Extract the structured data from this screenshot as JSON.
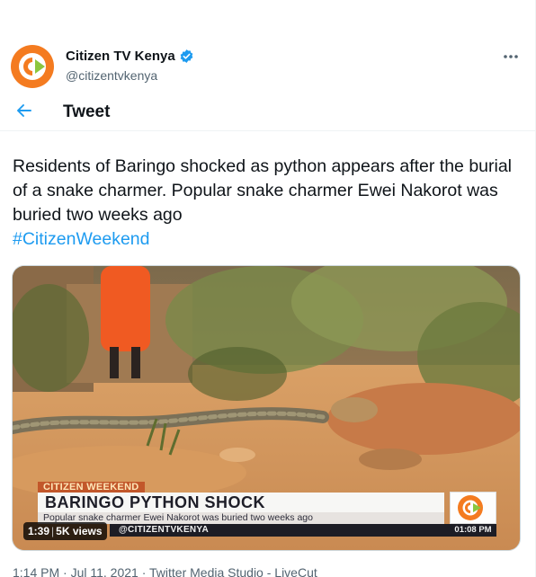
{
  "account": {
    "name": "Citizen TV Kenya",
    "handle": "@citizentvkenya",
    "verified": true
  },
  "header": {
    "title": "Tweet"
  },
  "tweet": {
    "text": "Residents of Baringo shocked as python appears after the burial of a snake charmer. Popular snake charmer Ewei Nakorot was buried two weeks ago",
    "hashtag": "#CitizenWeekend"
  },
  "media": {
    "segment": "CITIZEN WEEKEND",
    "headline": "BARINGO PYTHON SHOCK",
    "subheadline": "Popular snake charmer Ewei Nakorot was buried two weeks ago",
    "channel_handle": "@CITIZENTVKENYA",
    "broadcast_time": "01:08 PM",
    "duration": "1:39",
    "views": "5K views"
  },
  "meta": {
    "timestamp": "1:14 PM · Jul 11, 2021 · Twitter Media Studio - LiveCut"
  },
  "colors": {
    "accent": "#1d9bf0",
    "text": "#0f1419",
    "muted": "#536471",
    "brand_orange": "#f47b20",
    "brand_green": "#8cc63f"
  },
  "icons": {
    "back": "arrow-left-icon",
    "more": "more-horizontal-icon",
    "verified": "verified-badge-icon"
  }
}
